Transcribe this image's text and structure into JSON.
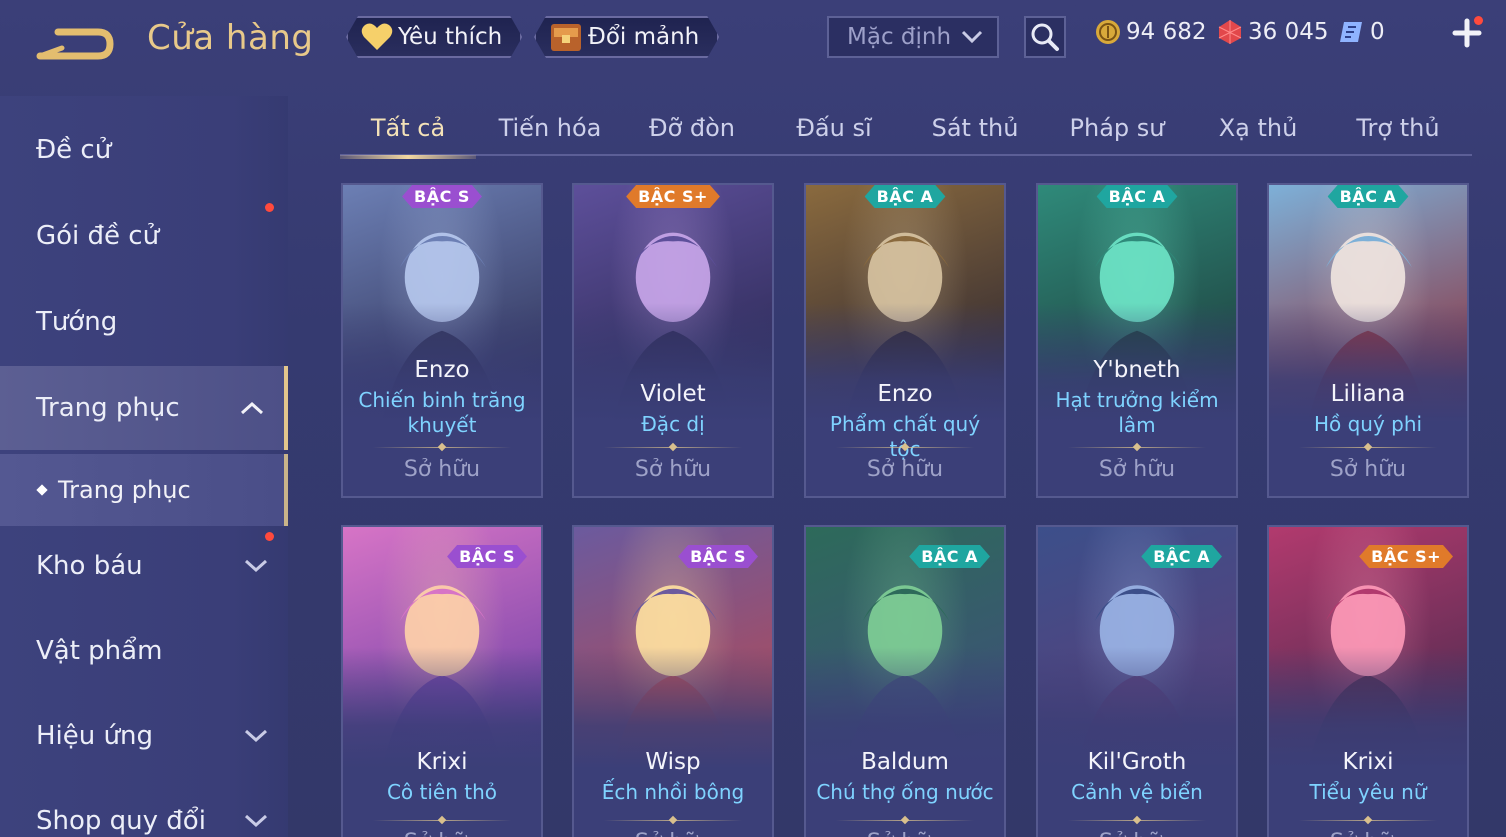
{
  "header": {
    "title": "Cửa hàng",
    "favorites_label": "Yêu thích",
    "exchange_label": "Đổi mảnh",
    "sort_value": "Mặc định",
    "currencies": [
      {
        "name": "gold",
        "value": "94 682"
      },
      {
        "name": "vouchers",
        "value": "36 045"
      },
      {
        "name": "tickets",
        "value": "0"
      }
    ]
  },
  "sidebar": {
    "items": [
      {
        "label": "Đề cử"
      },
      {
        "label": "Gói đề cử"
      },
      {
        "label": "Tướng"
      },
      {
        "label": "Trang phục"
      },
      {
        "label": "Kho báu"
      },
      {
        "label": "Vật phẩm"
      },
      {
        "label": "Hiệu ứng"
      },
      {
        "label": "Shop quy đổi"
      }
    ],
    "sub_item": "Trang phục"
  },
  "tabs": [
    "Tất cả",
    "Tiến hóa",
    "Đỡ đòn",
    "Đấu sĩ",
    "Sát thủ",
    "Pháp sư",
    "Xạ thủ",
    "Trợ thủ"
  ],
  "cards": [
    {
      "badge": "BẬC S",
      "name": "Enzo",
      "skin": "Chiến binh trăng khuyết",
      "status": "Sở hữu"
    },
    {
      "badge": "BẬC S+",
      "name": "Violet",
      "skin": "Đặc dị",
      "status": "Sở hữu"
    },
    {
      "badge": "BẬC A",
      "name": "Enzo",
      "skin": "Phẩm chất quý tộc",
      "status": "Sở hữu"
    },
    {
      "badge": "BẬC A",
      "name": "Y'bneth",
      "skin": "Hạt trưởng kiểm lâm",
      "status": "Sở hữu"
    },
    {
      "badge": "BẬC A",
      "name": "Liliana",
      "skin": "Hồ quý phi",
      "status": "Sở hữu"
    },
    {
      "badge": "BẬC S",
      "name": "Krixi",
      "skin": "Cô tiên thỏ",
      "status": "Sở hữu"
    },
    {
      "badge": "BẬC S",
      "name": "Wisp",
      "skin": "Ếch nhồi bông",
      "status": "Sở hữu"
    },
    {
      "badge": "BẬC A",
      "name": "Baldum",
      "skin": "Chú thợ ống nước",
      "status": "Sở hữu"
    },
    {
      "badge": "BẬC A",
      "name": "Kil'Groth",
      "skin": "Cảnh vệ biển",
      "status": "Sở hữu"
    },
    {
      "badge": "BẬC S+",
      "name": "Krixi",
      "skin": "Tiểu yêu nữ",
      "status": "Sở hữu"
    }
  ],
  "colors": {
    "badge_s": "#9a4fd0",
    "badge_s_plus": "#e07a2a",
    "badge_a": "#1fa6a0",
    "accent_gold": "#e8c98a",
    "skin_text": "#7fd3ff"
  }
}
